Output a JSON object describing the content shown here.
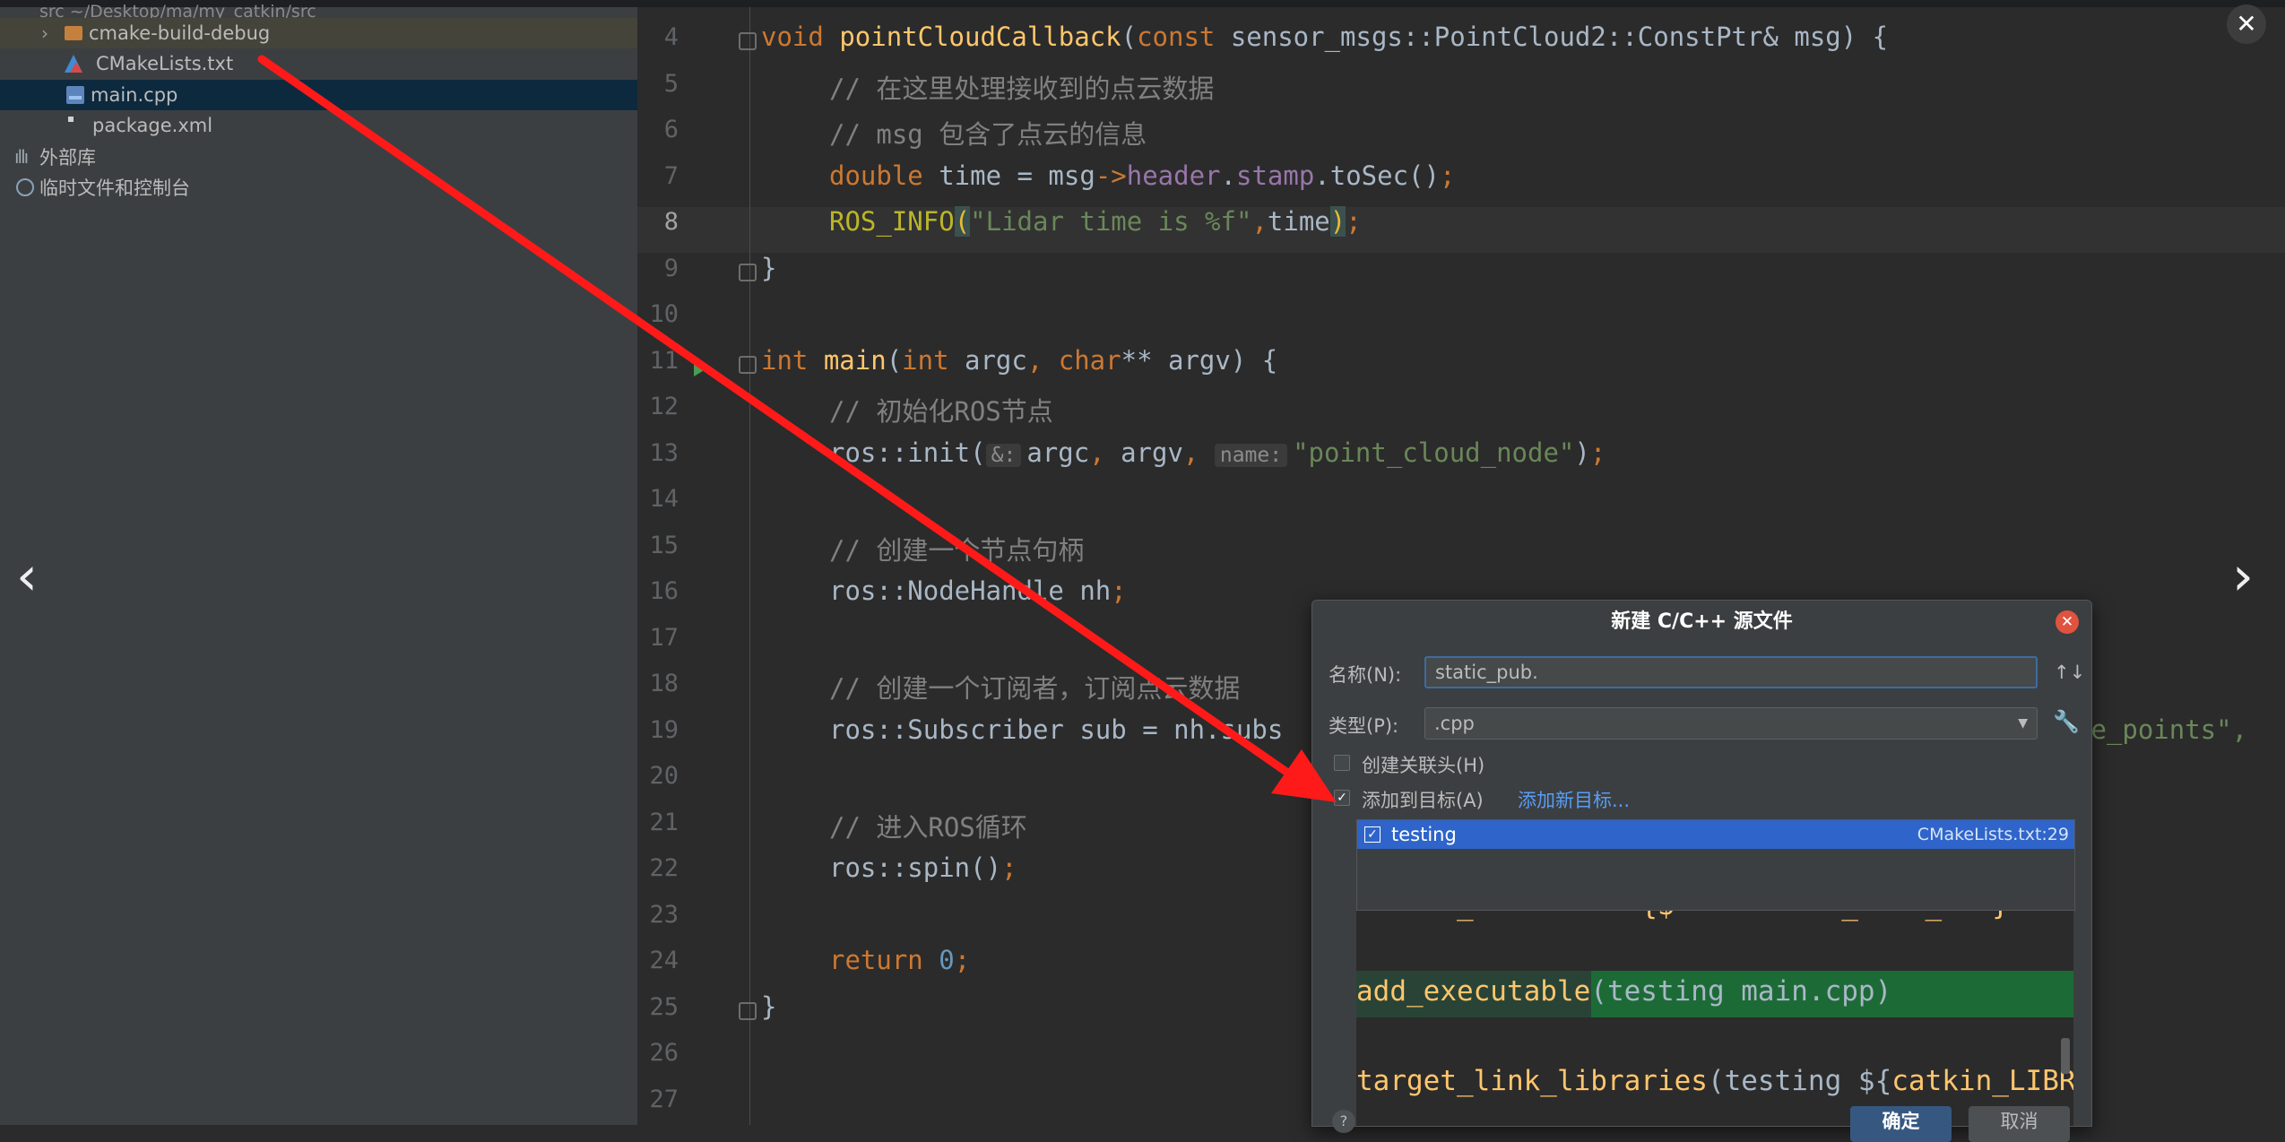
{
  "tree": {
    "root_path": "src ~/Desktop/ma/my_catkin/src",
    "items": [
      {
        "label": "cmake-build-debug"
      },
      {
        "label": "CMakeLists.txt"
      },
      {
        "label": "main.cpp"
      },
      {
        "label": "package.xml"
      },
      {
        "label": "外部库"
      },
      {
        "label": "临时文件和控制台"
      }
    ]
  },
  "editor": {
    "line_numbers": [
      "4",
      "5",
      "6",
      "7",
      "8",
      "9",
      "10",
      "11",
      "12",
      "13",
      "14",
      "15",
      "16",
      "17",
      "18",
      "19",
      "20",
      "21",
      "22",
      "23",
      "24",
      "25",
      "26",
      "27"
    ],
    "current_line": "8",
    "hints": {
      "amp": "&:",
      "name": "name:"
    },
    "code": {
      "l4": {
        "a": "void ",
        "b": "pointCloudCallback",
        "c": "(",
        "d": "const ",
        "e": "sensor_msgs::PointCloud2::ConstPtr& msg) {"
      },
      "l5": "// 在这里处理接收到的点云数据",
      "l6": "// msg 包含了点云的信息",
      "l7": {
        "a": "double ",
        "b": "time = msg",
        "c": "->",
        "d": "header",
        "e": ".",
        "f": "stamp",
        "g": ".toSec()",
        "h": ";"
      },
      "l8": {
        "a": "ROS_INFO",
        "b": "(",
        "c": "\"Lidar time is %f\"",
        "d": ",",
        "e": "time",
        "f": ")",
        "g": ";"
      },
      "l9": "}",
      "l11": {
        "a": "int ",
        "b": "main",
        "c": "(",
        "d": "int ",
        "e": "argc",
        "f": ", ",
        "g": "char",
        "h": "** argv) {"
      },
      "l12": "// 初始化ROS节点",
      "l13": {
        "a": "ros::init(",
        "b": "argc",
        "c": ", ",
        "d": "argv",
        "e": ", ",
        "f": "\"point_cloud_node\"",
        "g": ")",
        "h": ";"
      },
      "l15": "// 创建一个节点句柄",
      "l16": {
        "a": "ros::NodeHandle nh",
        "b": ";"
      },
      "l18": "// 创建一个订阅者，订阅点云数据",
      "l19": {
        "a": "ros::Subscriber sub = nh.subs",
        "b": "he_points\","
      },
      "l21": "// 进入ROS循环",
      "l22": {
        "a": "ros::spin()",
        "b": ";"
      },
      "l24": {
        "a": "return ",
        "b": "0",
        "c": ";"
      },
      "l25": "}"
    }
  },
  "dialog": {
    "title": "新建 C/C++ 源文件",
    "name_label": "名称(N):",
    "name_value": "static_pub.",
    "type_label": "类型(P):",
    "type_value": ".cpp",
    "header_label": "创建关联头(H)",
    "add_target_label": "添加到目标(A)",
    "add_new_target": "添加新目标...",
    "target": {
      "name": "testing",
      "ref": "CMakeLists.txt:29"
    },
    "preview": {
      "line1": "      _          {$          _    _   }",
      "line2a": "add_executable",
      "line2b": "(testing main.cpp)",
      "line3a": "target_link_libraries",
      "line3b": "(testing ${",
      "line3c": "catkin_LIBR"
    },
    "help": "?",
    "ok": "确定",
    "cancel": "取消"
  },
  "overlay": {
    "prev": "‹",
    "next": "›",
    "close": "✕"
  },
  "colors": {
    "arrow": "#ff1a1a",
    "selection": "#2f65ca",
    "editor_bg": "#2b2b2b",
    "sidebar_bg": "#3c3f41"
  }
}
